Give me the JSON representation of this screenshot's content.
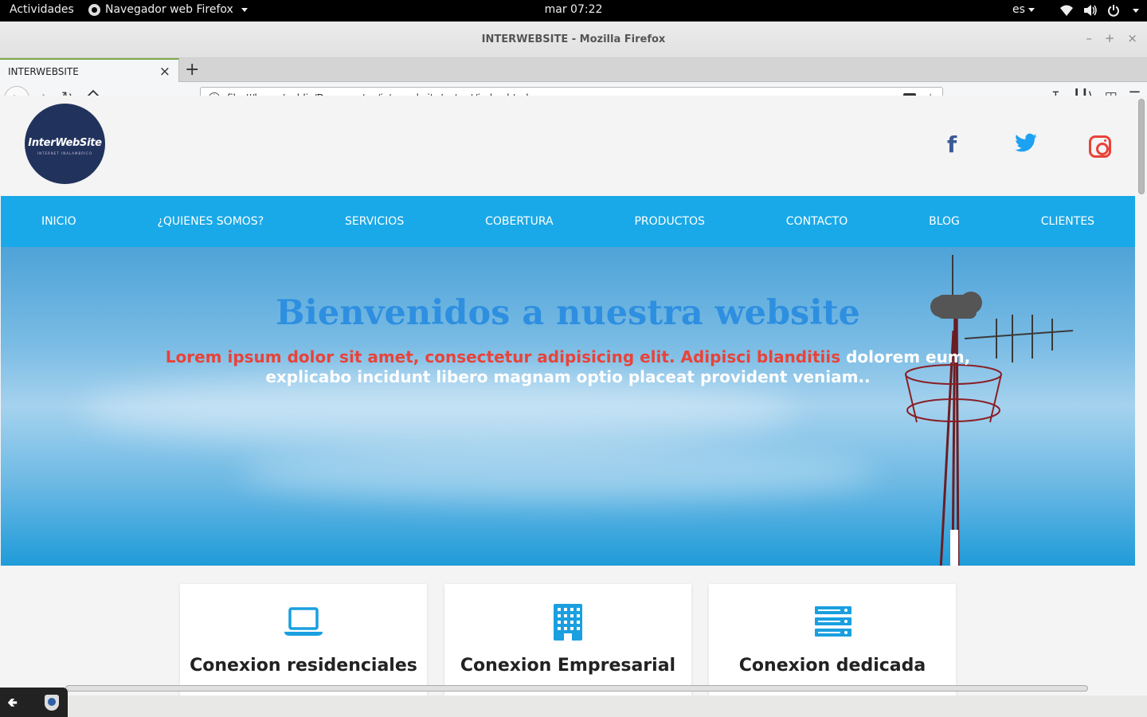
{
  "system": {
    "activities": "Actividades",
    "app_name": "Navegador web Firefox",
    "clock": "mar 07:22",
    "language": "es"
  },
  "browser": {
    "window_title": "INTERWEBSITE - Mozilla Firefox",
    "tab_title": "INTERWEBSITE",
    "url": "file:///home/public/Documentos/interwebsite/output/index.html"
  },
  "site": {
    "logo": {
      "brand": "InterWebSite",
      "tagline": "INTERNET INALAMBRICO"
    },
    "social": [
      "facebook-icon",
      "twitter-icon",
      "instagram-icon"
    ],
    "nav": [
      {
        "label": "INICIO"
      },
      {
        "label": "¿QUIENES SOMOS?"
      },
      {
        "label": "SERVICIOS"
      },
      {
        "label": "COBERTURA"
      },
      {
        "label": "PRODUCTOS"
      },
      {
        "label": "CONTACTO"
      },
      {
        "label": "BLOG"
      },
      {
        "label": "CLIENTES"
      }
    ],
    "hero": {
      "title": "Bienvenidos a nuestra website",
      "subtitle_red": "Lorem ipsum dolor sit amet, consectetur adipisicing elit. Adipisci blanditiis",
      "subtitle_white": " dolorem eum, explicabo incidunt libero magnam optio placeat provident veniam.."
    },
    "cards": [
      {
        "title": "Conexion residenciales",
        "icon": "laptop-icon"
      },
      {
        "title": "Conexion Empresarial",
        "icon": "building-icon"
      },
      {
        "title": "Conexion dedicada",
        "icon": "server-icon"
      }
    ]
  },
  "colors": {
    "nav_bg": "#19a9e8",
    "hero_title": "#2e8fe0",
    "accent_red": "#e8433a",
    "logo_bg": "#21335c",
    "icon_blue": "#1a9fe0"
  }
}
